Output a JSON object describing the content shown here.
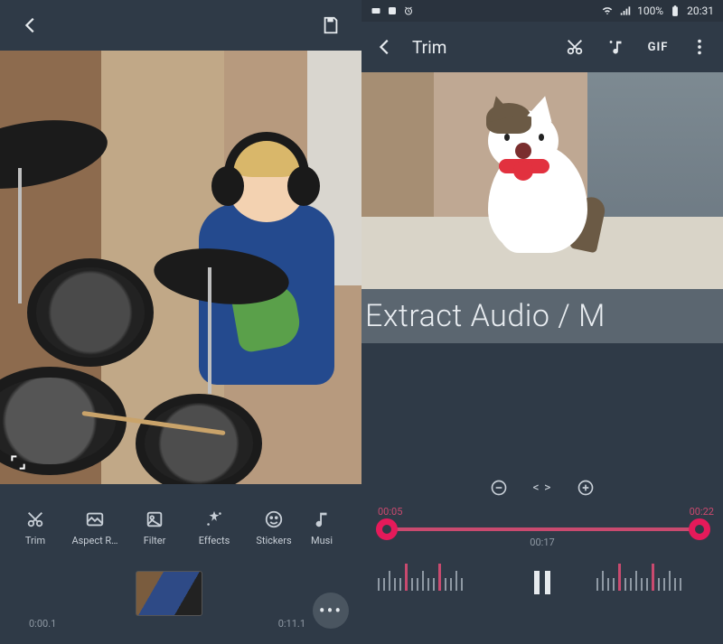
{
  "left": {
    "tools": {
      "trim": "Trim",
      "aspect": "Aspect R…",
      "filter": "Filter",
      "effects": "Effects",
      "stickers": "Stickers",
      "music": "Musi"
    },
    "timeline": {
      "start": "0:00.1",
      "end": "0:11.1"
    }
  },
  "right": {
    "status": {
      "battery": "100%",
      "time": "20:31"
    },
    "title": "Trim",
    "gif_label": "GIF",
    "caption": "Extract Audio / M",
    "zoom": {
      "snap": "< >"
    },
    "trim": {
      "start": "00:05",
      "end": "00:22",
      "mid": "00:17"
    }
  }
}
